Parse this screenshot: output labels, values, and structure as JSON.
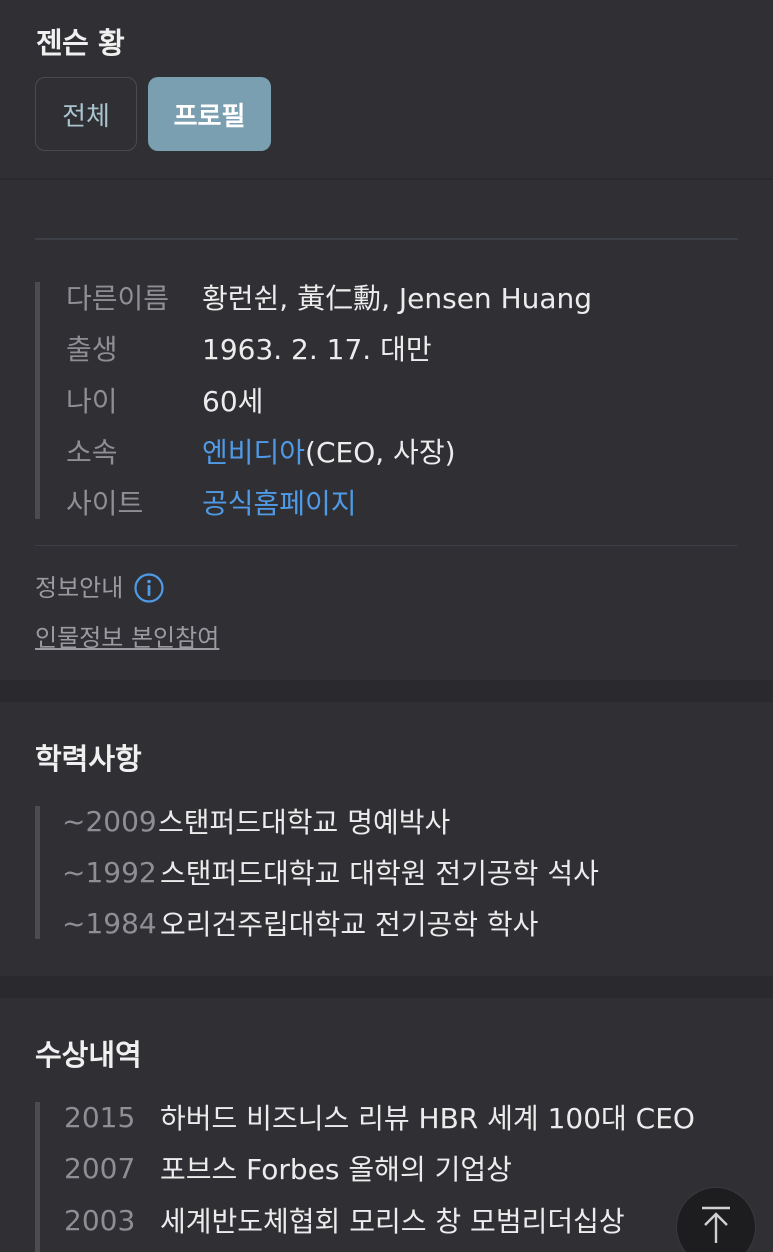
{
  "header": {
    "title": "젠슨 황",
    "tabs": [
      {
        "label": "전체",
        "selected": false
      },
      {
        "label": "프로필",
        "selected": true
      }
    ]
  },
  "profile": {
    "rows": [
      {
        "label": "다른이름",
        "value": "황런쉰, 黃仁勳, Jensen Huang"
      },
      {
        "label": "출생",
        "value": "1963. 2. 17. 대만"
      },
      {
        "label": "나이",
        "value": "60세"
      },
      {
        "label": "소속",
        "value_link": "엔비디아",
        "value_rest": "(CEO, 사장)"
      },
      {
        "label": "사이트",
        "value_link": "공식홈페이지"
      }
    ],
    "notice": "정보안내",
    "self_link": "인물정보 본인참여"
  },
  "education": {
    "title": "학력사항",
    "items": [
      {
        "year": "~2009",
        "text": "스탠퍼드대학교 명예박사"
      },
      {
        "year": "~1992",
        "text": "스탠퍼드대학교 대학원 전기공학 석사"
      },
      {
        "year": "~1984",
        "text": "오리건주립대학교 전기공학 학사"
      }
    ]
  },
  "awards": {
    "title": "수상내역",
    "items": [
      {
        "year": "2015",
        "text": "하버드 비즈니스 리뷰 HBR 세계 100대 CEO"
      },
      {
        "year": "2007",
        "text": "포브스 Forbes 올해의 기업상"
      },
      {
        "year": "2003",
        "text": "세계반도체협회 모리스 창 모범리더십상"
      }
    ]
  },
  "colors": {
    "accent": "#7a9fb1",
    "link": "#4f9ae6",
    "background": "#2a2a2e",
    "card": "#303034"
  },
  "icons": {
    "notice": "info-circle-icon",
    "scroll_top": "arrow-up-icon"
  }
}
